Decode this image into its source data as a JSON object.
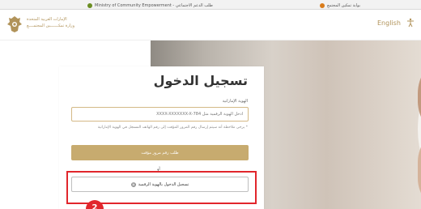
{
  "browser": {
    "tab_left_label": "Ministry of Community Empowerment - طلب الدعم الاجتماعي",
    "tab_right_label": "بوابة تمكين المجتمع"
  },
  "header": {
    "ministry_name_line1": "الإمارات العربية المتحدة",
    "ministry_name_line2": "وزارة تمكـــــــين المجتمــــع",
    "language_link": "English"
  },
  "login": {
    "title": "تسجيل الدخول",
    "emirates_id_label": "الهوية الإماراتية",
    "emirates_id_placeholder": "أدخل الهوية الرقمية مثل 784-XXXX-XXXXXXX-X",
    "emirates_id_value": "",
    "note": "* يرجى ملاحظة أنه سيتم إرسال رقم المرور المؤقت إلى رقم الهاتف المسجل في الهوية الإماراتية",
    "otp_button_label": "طلب رقم مرور مؤقت",
    "or_label": "أو",
    "uaepass_button_label": "تسجيل الدخول بالهوية الرقمية"
  },
  "annotation": {
    "step_number": "2"
  },
  "colors": {
    "gold": "#c7ab6f",
    "highlight_red": "#e1262c"
  }
}
